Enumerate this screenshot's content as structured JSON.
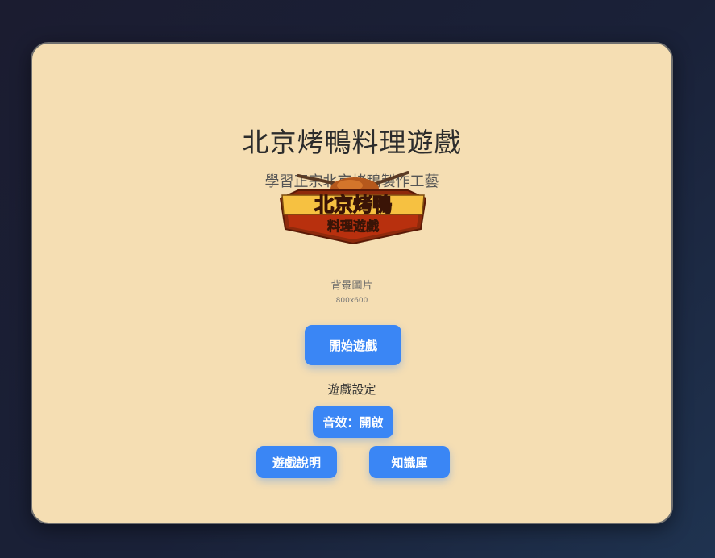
{
  "game": {
    "title": "北京烤鴨料理遊戲",
    "subtitle": "學習正宗北京烤鴨製作工藝",
    "logo": {
      "line1": "北京烤鴨",
      "line2": "料理遊戲"
    },
    "background_placeholder": {
      "label": "背景圖片",
      "size": "800x600"
    },
    "start_button": "開始遊戲",
    "settings_label": "遊戲設定",
    "sound_button": "音效：開啟",
    "help_button": "遊戲說明",
    "knowledge_button": "知識庫"
  },
  "colors": {
    "page_background": "#1a2138",
    "panel_background": "#f5deb3",
    "button": "#3a86f5",
    "logo_red": "#b8300e",
    "logo_gold": "#f6c141"
  }
}
